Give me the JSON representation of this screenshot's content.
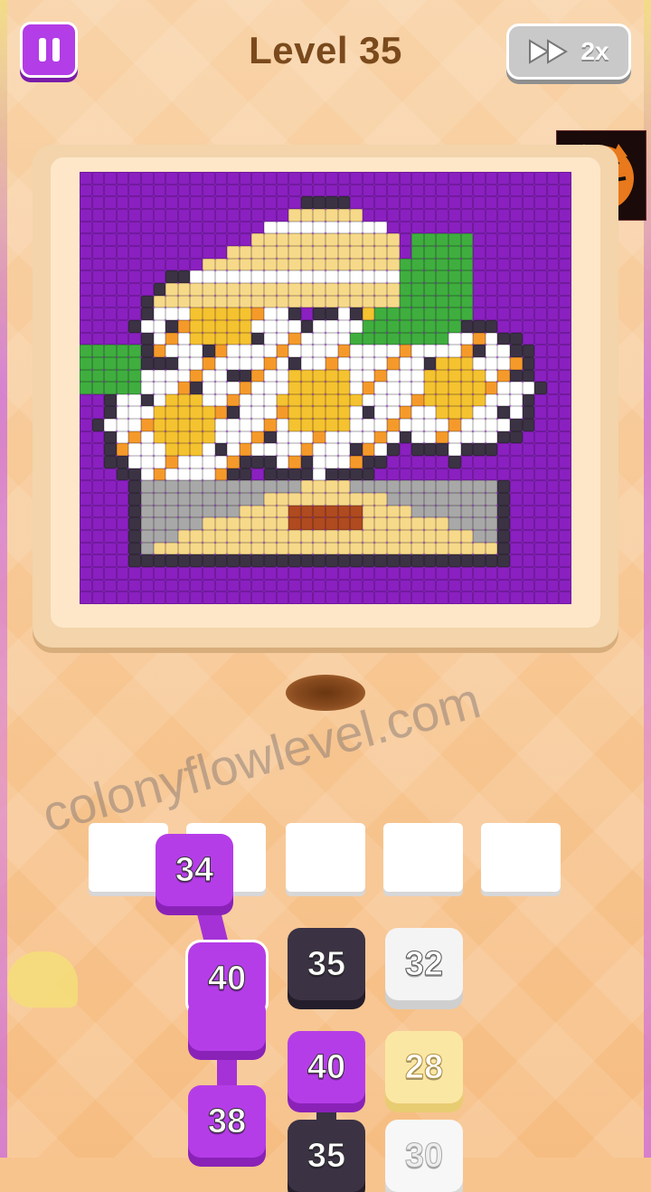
{
  "header": {
    "level_title": "Level 35",
    "speed_label": "2x"
  },
  "watermark": "colonyflowlevel.com",
  "colors": {
    "accent_purple": "#b53de8",
    "grid_purple": "#8a20c0",
    "dark": "#3b3244",
    "cream": "#f7d98a",
    "flower_white": "#ffffff",
    "flower_yellow": "#f5c230",
    "petal_orange": "#f59a2a",
    "leaf_green": "#3fae3f",
    "gray_unknown": "#a8a8a8",
    "brown": "#b04a20"
  },
  "icons": [
    "pause-icon",
    "fast-forward-icon",
    "tiger-logo"
  ],
  "slots": [
    "",
    "",
    "",
    "",
    ""
  ],
  "tokens": {
    "t1": "34",
    "t2": "40",
    "t3": "38",
    "t4": "35",
    "t5": "32",
    "t6": "40",
    "t7": "28",
    "t8": "35",
    "t9": "30"
  }
}
